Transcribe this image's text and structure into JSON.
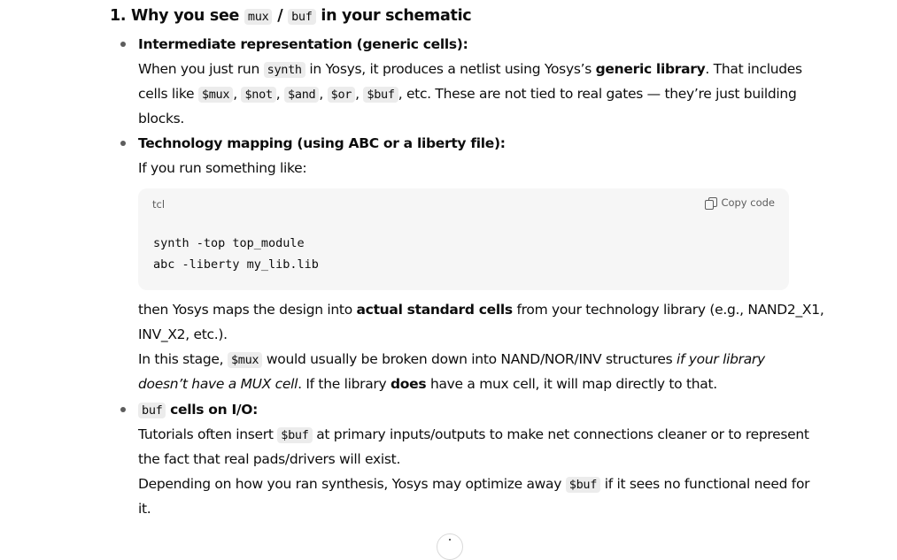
{
  "heading": {
    "prefix": "1. Why you see",
    "code1": "mux",
    "sep": "/",
    "code2": "buf",
    "suffix": "in your schematic"
  },
  "section1": {
    "title": "Intermediate representation (generic cells):",
    "l1_a": "When you just run",
    "l1_code": "synth",
    "l1_b": "in Yosys, it produces a netlist using Yosys’s",
    "l1_bold": "generic library",
    "l1_c": ". That includes",
    "l2_a": "cells like",
    "cells": [
      "$mux",
      "$not",
      "$and",
      "$or",
      "$buf"
    ],
    "l2_b": ", etc. These are not tied to real gates — they’re just building",
    "l3": "blocks."
  },
  "section2": {
    "title": "Technology mapping (using ABC or a liberty file):",
    "intro": "If you run something like:",
    "code_lang": "tcl",
    "copy_label": "Copy code",
    "code_line1": "synth -top top_module",
    "code_line2": "abc -liberty my_lib.lib",
    "l4_a": "then Yosys maps the design into",
    "l4_bold": "actual standard cells",
    "l4_b": "from your technology library (e.g., NAND2_X1,",
    "l5": "INV_X2, etc.).",
    "l6_a": "In this stage,",
    "l6_code": "$mux",
    "l6_b": "would usually be broken down into NAND/NOR/INV structures",
    "l6_italic": "if your library",
    "l7_italic": "doesn’t have a MUX cell",
    "l7_a": ". If the library",
    "l7_bold": "does",
    "l7_b": "have a mux cell, it will map directly to that."
  },
  "section3": {
    "title_code": "buf",
    "title": "cells on I/O:",
    "l1_a": "Tutorials often insert",
    "l1_code": "$buf",
    "l1_b": "at primary inputs/outputs to make net connections cleaner or to represent",
    "l2": "the fact that real pads/drivers will exist.",
    "l3_a": "Depending on how you ran synthesis, Yosys may optimize away",
    "l3_code": "$buf",
    "l3_b": "if it sees no functional need for",
    "l4": "it."
  }
}
